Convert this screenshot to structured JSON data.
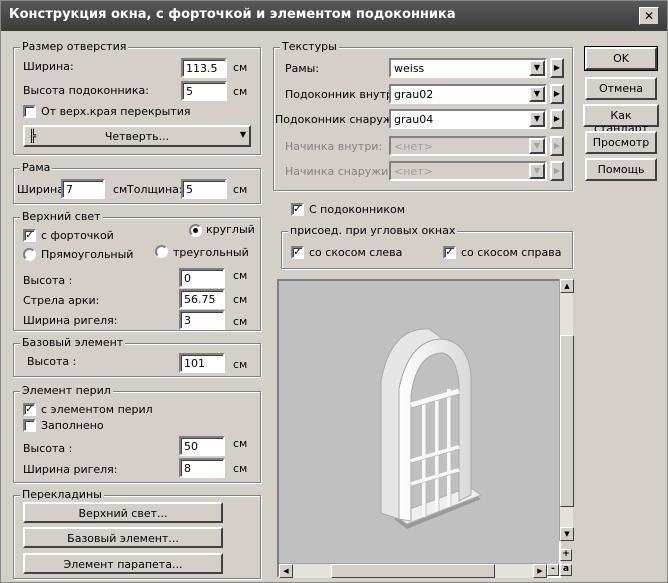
{
  "window": {
    "title": "Конструкция окна, с форточкой  и элементом подоконника",
    "close": "✕"
  },
  "opening": {
    "legend": "Размер отверстия",
    "width_label": "Ширина:",
    "width_value": "113.5",
    "width_unit": "см",
    "sill_label": "Высота подоконника:",
    "sill_value": "5",
    "sill_unit": "см",
    "from_top_label": "От верх.края перекрытия",
    "quarter_button": "Четверть..."
  },
  "frame": {
    "legend": "Рама",
    "width_label": "Ширина:",
    "width_value": "7",
    "width_unit": "см",
    "thickness_label": "Толщина:",
    "thickness_value": "5",
    "thickness_unit": "см"
  },
  "top_light": {
    "legend": "Верхний свет",
    "vent_label": "с форточкой",
    "round_label": "круглый",
    "rect_label": "Прямоугольный",
    "tri_label": "треугольный",
    "height_label": "Высота :",
    "height_value": "0",
    "height_unit": "см",
    "arc_label": "Стрела арки:",
    "arc_value": "56.75",
    "arc_unit": "см",
    "transom_label": "Ширина ригеля:",
    "transom_value": "3",
    "transom_unit": "см"
  },
  "base": {
    "legend": "Базовый элемент",
    "height_label": "Высота :",
    "height_value": "101",
    "height_unit": "см"
  },
  "railing": {
    "legend": "Элемент перил",
    "with_label": "с элементом перил",
    "filled_label": "Заполнено",
    "height_label": "Высота :",
    "height_value": "50",
    "height_unit": "см",
    "transom_label": "Ширина ригеля:",
    "transom_value": "8",
    "transom_unit": "см"
  },
  "lintels": {
    "legend": "Перекладины",
    "top_light_btn": "Верхний свет...",
    "base_btn": "Базовый элемент...",
    "parapet_btn": "Элемент парапета..."
  },
  "textures": {
    "legend": "Текстуры",
    "frames_label": "Рамы:",
    "frames_value": "weiss",
    "sill_in_label": "Подоконник внутри:",
    "sill_in_value": "grau02",
    "sill_out_label": "Подоконник снаружи:",
    "sill_out_value": "grau04",
    "fill_in_label": "Начинка внутри:",
    "fill_in_value": "<нет>",
    "fill_out_label": "Начинка снаружи:",
    "fill_out_value": "<нет>"
  },
  "with_sill_label": "С подоконником",
  "corner": {
    "legend": "присоед. при угловых окнах",
    "left_label": "со скосом слева",
    "right_label": "со скосом справа"
  },
  "buttons": {
    "ok": "OK",
    "cancel": "Отмена",
    "standard": "Как стандарт",
    "preview": "Просмотр",
    "help": "Помощь"
  },
  "preview_tools": {
    "plus": "+",
    "minus": "-",
    "a": "a"
  },
  "colors": {
    "dialog_bg": "#d4d0c8",
    "title_bg": "#4a4a4a",
    "preview_bg": "#c0c0c0"
  }
}
